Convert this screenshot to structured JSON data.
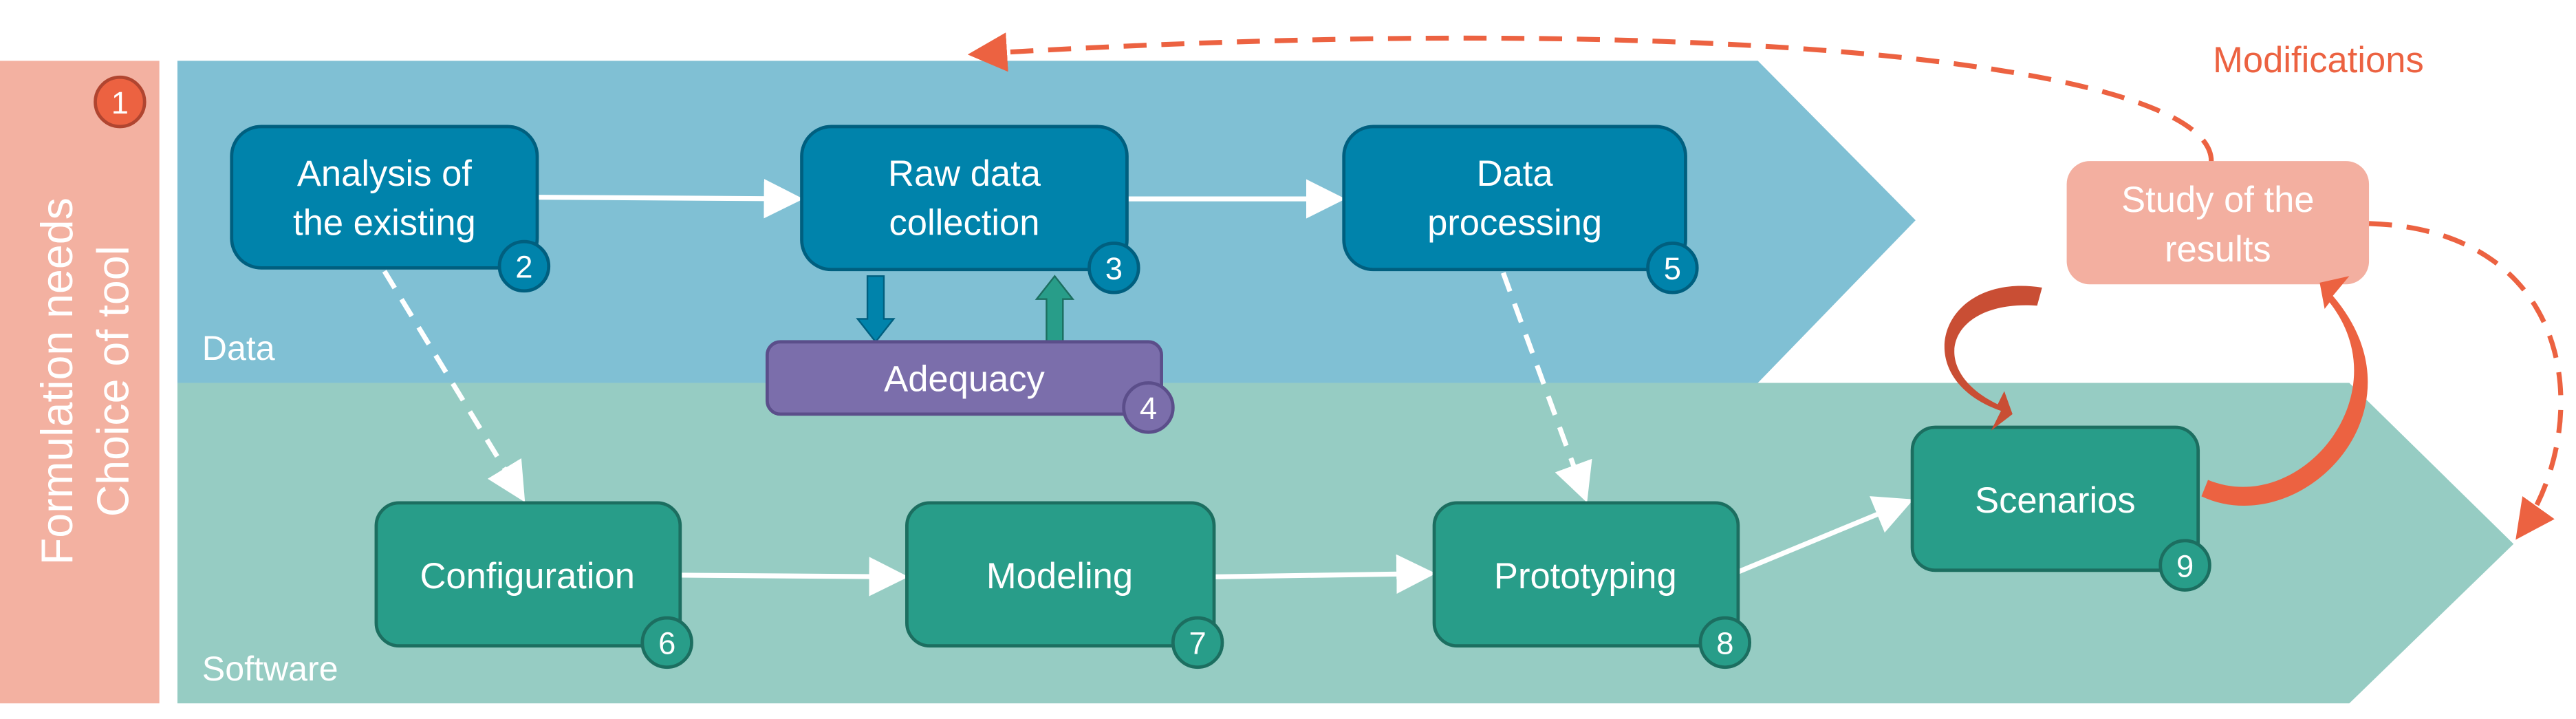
{
  "sidebar": {
    "line1": "Formulation needs",
    "line2": "Choice of tool",
    "badge": "1"
  },
  "bands": {
    "data": "Data",
    "software": "Software"
  },
  "steps": {
    "analysis": {
      "line1": "Analysis of",
      "line2": "the existing",
      "badge": "2"
    },
    "raw": {
      "line1": "Raw data",
      "line2": "collection",
      "badge": "3"
    },
    "adequacy": {
      "label": "Adequacy",
      "badge": "4"
    },
    "processing": {
      "line1": "Data",
      "line2": "processing",
      "badge": "5"
    },
    "configuration": {
      "label": "Configuration",
      "badge": "6"
    },
    "modeling": {
      "label": "Modeling",
      "badge": "7"
    },
    "prototyping": {
      "label": "Prototyping",
      "badge": "8"
    },
    "scenarios": {
      "label": "Scenarios",
      "badge": "9"
    },
    "study": {
      "line1": "Study of the",
      "line2": "results"
    }
  },
  "modifications": "Modifications",
  "colors": {
    "data_band": "#80C0D4",
    "software_band": "#96CCC3",
    "blue_box": "#0083AB",
    "green_box": "#289D89",
    "purple_box": "#7B6EAB",
    "pink": "#F3AFA0",
    "red": "#EC6241"
  }
}
